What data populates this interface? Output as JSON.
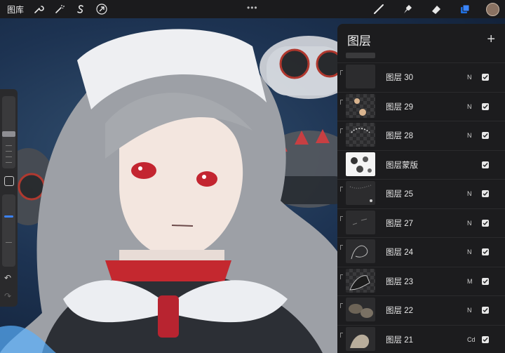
{
  "toolbar": {
    "gallery_label": "图库",
    "left_tools": [
      "wrench-icon",
      "magic-wand-icon",
      "selection-icon",
      "transform-arrow-icon"
    ],
    "more_label": "•••",
    "right_tools": [
      "brush-icon",
      "smudge-icon",
      "eraser-icon",
      "layers-icon"
    ],
    "accent_color": "#1f6fe0",
    "current_color": "#8a7262"
  },
  "sidebar": {
    "undo_icon": "undo-icon",
    "redo_icon": "redo-icon",
    "modify_icon": "square-icon",
    "opacity_level": 0.3,
    "size_level": 0.5
  },
  "layers_panel": {
    "title": "图层",
    "add_label": "+",
    "layers": [
      {
        "name": "图层 30",
        "mode": "N",
        "visible": true
      },
      {
        "name": "图层 29",
        "mode": "N",
        "visible": true
      },
      {
        "name": "图层 28",
        "mode": "N",
        "visible": true
      },
      {
        "name": "图层蒙版",
        "mode": "",
        "visible": true
      },
      {
        "name": "图层 25",
        "mode": "N",
        "visible": true
      },
      {
        "name": "图层 27",
        "mode": "N",
        "visible": true
      },
      {
        "name": "图层 24",
        "mode": "N",
        "visible": true
      },
      {
        "name": "图层 23",
        "mode": "M",
        "visible": true
      },
      {
        "name": "图层 22",
        "mode": "N",
        "visible": true
      },
      {
        "name": "图层 21",
        "mode": "Cd",
        "visible": true
      }
    ]
  }
}
